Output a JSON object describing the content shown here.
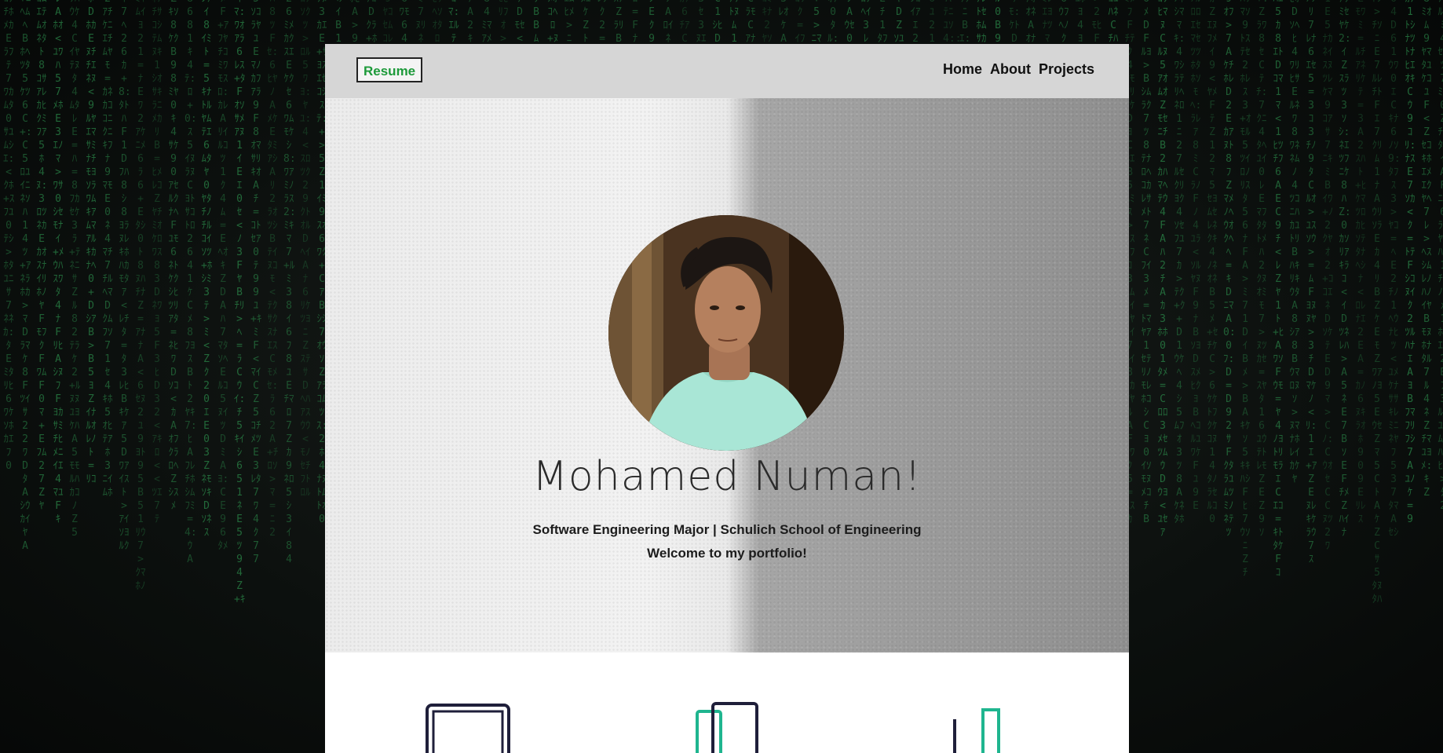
{
  "nav": {
    "resume_label": "Resume",
    "links": [
      "Home",
      "About",
      "Projects"
    ]
  },
  "hero": {
    "name": "Mohamed Numan!",
    "subtitle": "Software Engineering Major | Schulich School of Engineering",
    "welcome": "Welcome to my portfolio!",
    "avatar_alt": "profile photo"
  },
  "icons": {
    "feature_1": "laptop-icon",
    "feature_2": "devices-icon",
    "feature_3": "chart-icon"
  },
  "colors": {
    "resume_text": "#1d9a3a",
    "navbar_bg": "#d6d6d6",
    "accent_teal": "#1fb58f",
    "icon_dark": "#1f1f3a",
    "matrix_green": "#2c8f4c"
  }
}
